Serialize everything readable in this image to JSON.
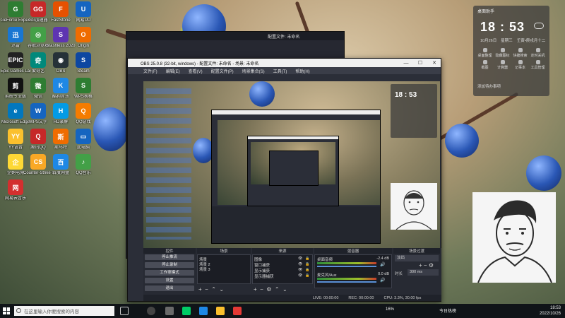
{
  "desktop": {
    "icons": [
      {
        "label": "GeForce Experience",
        "glyph": "G",
        "color": "#2e7d32"
      },
      {
        "label": "GG加速器",
        "glyph": "GG",
        "color": "#c62828"
      },
      {
        "label": "FastStone",
        "glyph": "F",
        "color": "#e65100"
      },
      {
        "label": "网易UU",
        "glyph": "U",
        "color": "#1565c0"
      },
      {
        "label": "迅雷",
        "glyph": "迅",
        "color": "#1976d2"
      },
      {
        "label": "谷歌浏览器",
        "glyph": "◎",
        "color": "#43a047"
      },
      {
        "label": "Stashless 2020",
        "glyph": "S",
        "color": "#5e35b1"
      },
      {
        "label": "Origin",
        "glyph": "O",
        "color": "#ef6c00"
      },
      {
        "label": "Epic Games Launcher",
        "glyph": "EPIC",
        "color": "#212121"
      },
      {
        "label": "爱奇艺",
        "glyph": "奇",
        "color": "#00897b"
      },
      {
        "label": "OBS",
        "glyph": "◉",
        "color": "#263238"
      },
      {
        "label": "Steam",
        "glyph": "S",
        "color": "#0d47a1"
      },
      {
        "label": "剪映专业版",
        "glyph": "剪",
        "color": "#111111"
      },
      {
        "label": "微信",
        "glyph": "微",
        "color": "#2e7d32"
      },
      {
        "label": "酷狗音乐",
        "glyph": "K",
        "color": "#1e88e5"
      },
      {
        "label": "WPS表格",
        "glyph": "S",
        "color": "#2e7d32"
      },
      {
        "label": "Microsoft Edge",
        "glyph": "e",
        "color": "#0277bd"
      },
      {
        "label": "WPS文字",
        "glyph": "W",
        "color": "#1565c0"
      },
      {
        "label": "HD录屏",
        "glyph": "H",
        "color": "#039be5"
      },
      {
        "label": "QQ游戏",
        "glyph": "Q",
        "color": "#f57c00"
      },
      {
        "label": "YY语音",
        "glyph": "YY",
        "color": "#fbc02d"
      },
      {
        "label": "腾讯QQ",
        "glyph": "Q",
        "color": "#c62828"
      },
      {
        "label": "斯马特",
        "glyph": "斯",
        "color": "#ef6c00"
      },
      {
        "label": "此电脑",
        "glyph": "▭",
        "color": "#1565c0"
      },
      {
        "label": "企鹅电竞",
        "glyph": "企",
        "color": "#fdd835"
      },
      {
        "label": "Counter-Strike Global",
        "glyph": "CS",
        "color": "#f9a825"
      },
      {
        "label": "百度网盘",
        "glyph": "百",
        "color": "#1e88e5"
      },
      {
        "label": "QQ音乐",
        "glyph": "♪",
        "color": "#43a047"
      },
      {
        "label": "网易云音乐",
        "glyph": "网",
        "color": "#d32f2f"
      }
    ]
  },
  "obs": {
    "title": "OBS 25.0.8 (32-bit, windows) - 配置文件: 未命名 - 场景: 未命名",
    "menu": [
      "文件(F)",
      "编辑(E)",
      "查看(V)",
      "配置文件(P)",
      "场景集合(S)",
      "工具(T)",
      "帮助(H)"
    ],
    "controls_title": "控件",
    "controls": [
      "停止推流",
      "停止录制",
      "工作室模式",
      "设置",
      "退出"
    ],
    "scenes_title": "场景",
    "scenes": [
      "场景",
      "场景 2",
      "场景 3"
    ],
    "sources_title": "来源",
    "sources": [
      "图像",
      "窗口捕获",
      "显示捕获",
      "显示器捕获"
    ],
    "mixer_title": "混音器",
    "mixer": [
      {
        "label": "桌面音频",
        "db": "-2.4 dB"
      },
      {
        "label": "麦克风/Aux",
        "db": "0.0 dB"
      }
    ],
    "transitions_title": "场景过渡",
    "transition_value": "淡出",
    "duration_label": "时长",
    "duration_value": "300 ms",
    "status": {
      "live": "LIVE: 00:00:00",
      "rec": "REC: 00:00:00",
      "cpu": "CPU: 3.3%, 30.00 fps"
    }
  },
  "back_window": {
    "title": "配置文件: 未命名"
  },
  "widget": {
    "title": "桌面助手",
    "time": "18 : 53",
    "date_parts": [
      "10月26日",
      "星期三",
      "壬寅•庚戌月十二"
    ],
    "items": [
      "桌面整理",
      "隐藏图标",
      "快捷搜索",
      "定时关机",
      "截图",
      "计算器",
      "记事本",
      "工具管理"
    ],
    "footer": "添加待办事项"
  },
  "taskbar": {
    "search_placeholder": "在这里输入你要搜索的内容",
    "tray_time": "18:53",
    "tray_date": "2022/10/26",
    "tray_extra": "今日热榜",
    "tray_pct": "16%"
  },
  "colors": {
    "accent": "#2b2e38",
    "meter_green": "#2f8f3a",
    "meter_red": "#c93a2a"
  }
}
